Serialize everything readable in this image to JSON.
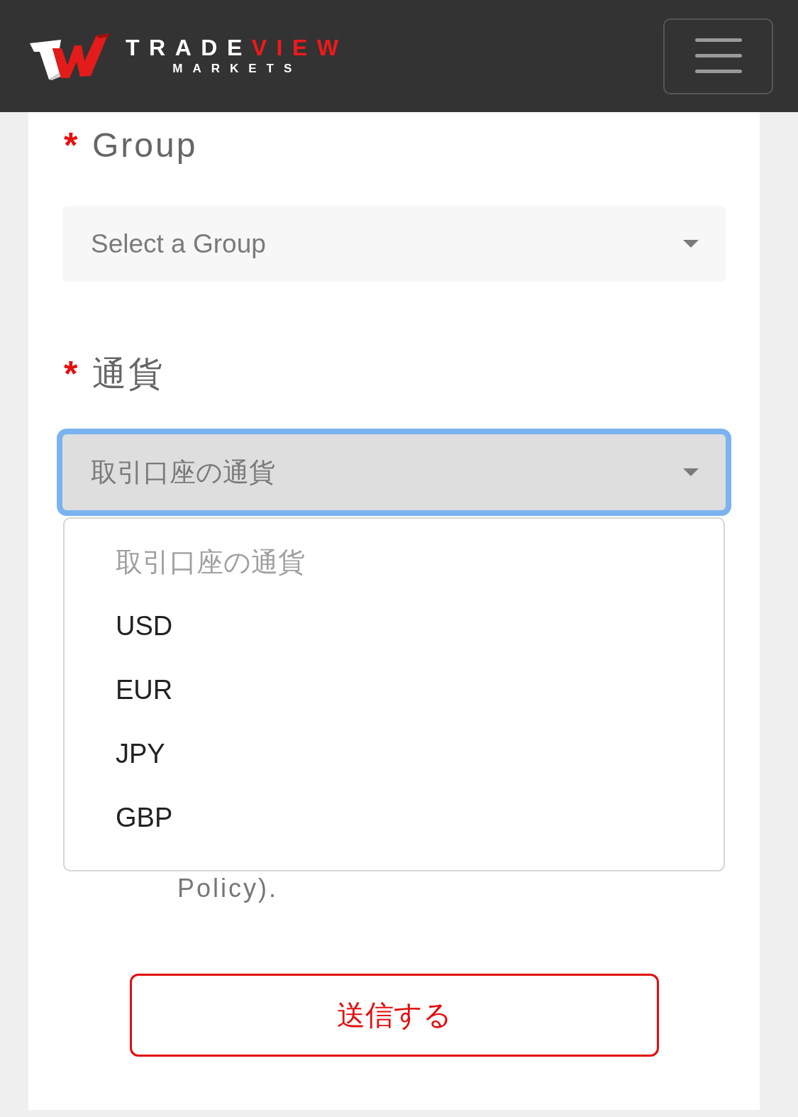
{
  "header": {
    "logo": {
      "name_part_1": "TRADE",
      "name_part_2": "VIEW",
      "subtitle": "MARKETS"
    }
  },
  "form": {
    "fields": [
      {
        "label": "Group",
        "required_mark": "*",
        "placeholder": "Select a Group",
        "focused": false
      },
      {
        "label": "通貨",
        "required_mark": "*",
        "placeholder": "取引口座の通貨",
        "focused": true,
        "expanded": true,
        "options": [
          {
            "label": "取引口座の通貨",
            "disabled": true,
            "selected": false
          },
          {
            "label": "USD",
            "disabled": false,
            "selected": false
          },
          {
            "label": "EUR",
            "disabled": false,
            "selected": false
          },
          {
            "label": "JPY",
            "disabled": false,
            "selected": false
          },
          {
            "label": "GBP",
            "disabled": false,
            "selected": false
          }
        ]
      }
    ],
    "partly_covered_text": "Policy).",
    "submit": {
      "label": "送信する"
    }
  }
}
